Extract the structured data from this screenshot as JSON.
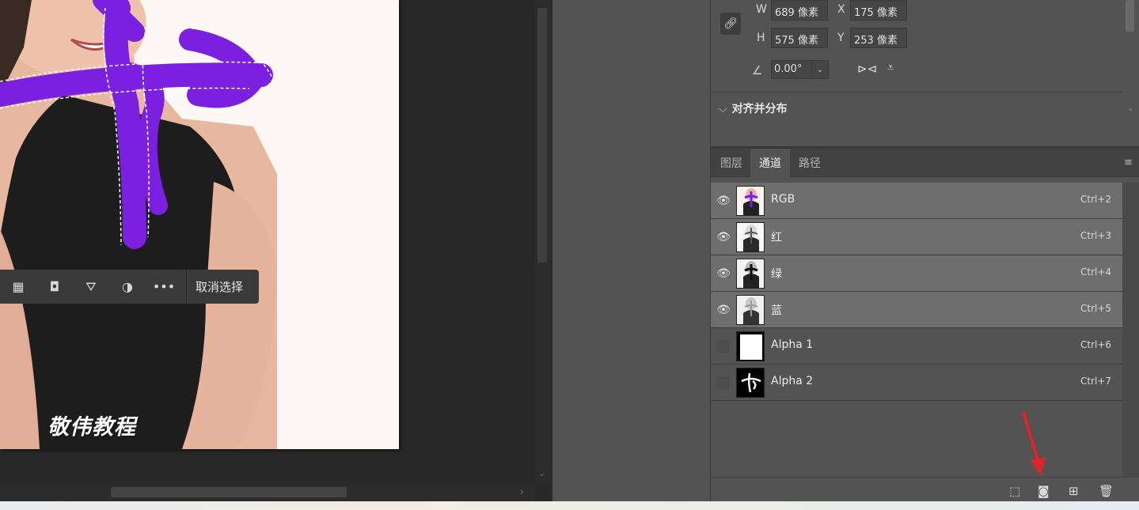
{
  "canvas": {
    "watermark": "敬伟教程",
    "context_bar": {
      "icons": [
        "checkerboard-icon",
        "mask-icon",
        "fill-bucket-icon",
        "adjustment-icon",
        "more-icon"
      ],
      "glyphs": [
        "▦",
        "◘",
        "⛛",
        "◑",
        "•••"
      ],
      "deselect_label": "取消选择"
    }
  },
  "properties": {
    "w_label": "W",
    "w_value": "689 像素",
    "h_label": "H",
    "h_value": "575 像素",
    "x_label": "X",
    "x_value": "175 像素",
    "y_label": "Y",
    "y_value": "253 像素",
    "angle_value": "0.00°",
    "section_title": "对齐并分布"
  },
  "channels_panel": {
    "tabs": [
      {
        "label": "图层",
        "active": false
      },
      {
        "label": "通道",
        "active": true
      },
      {
        "label": "路径",
        "active": false
      }
    ],
    "channels": [
      {
        "name": "RGB",
        "shortcut": "Ctrl+2",
        "visible": true
      },
      {
        "name": "红",
        "shortcut": "Ctrl+3",
        "visible": true
      },
      {
        "name": "绿",
        "shortcut": "Ctrl+4",
        "visible": true
      },
      {
        "name": "蓝",
        "shortcut": "Ctrl+5",
        "visible": true
      },
      {
        "name": "Alpha 1",
        "shortcut": "Ctrl+6",
        "visible": false
      },
      {
        "name": "Alpha 2",
        "shortcut": "Ctrl+7",
        "visible": false
      }
    ],
    "bottom_icons": [
      "load-selection-icon",
      "save-selection-icon",
      "new-channel-icon",
      "delete-channel-icon"
    ]
  },
  "colors": {
    "selection_purple": "#7b1fe0",
    "annotation_arrow": "#e0242a",
    "panel_bg": "#535353",
    "selected_row": "#6e6e6e"
  }
}
